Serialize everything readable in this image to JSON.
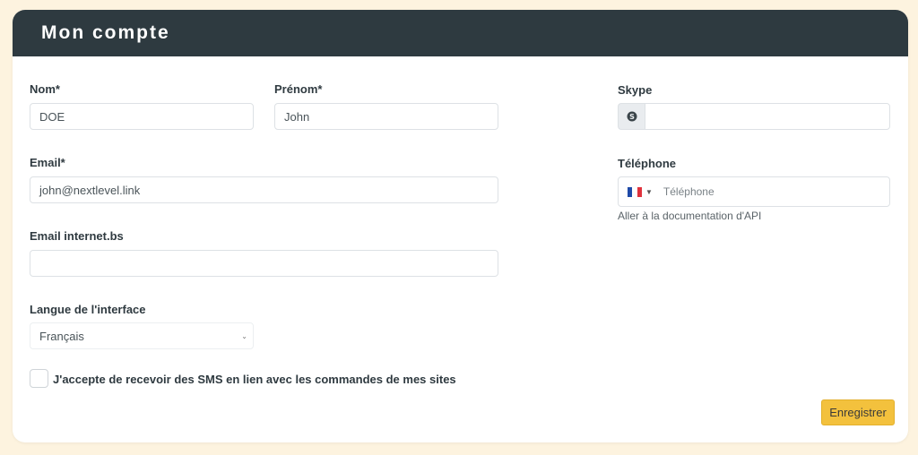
{
  "header": {
    "title": "Mon compte"
  },
  "form": {
    "nom": {
      "label": "Nom*",
      "value": "DOE"
    },
    "prenom": {
      "label": "Prénom*",
      "value": "John"
    },
    "email": {
      "label": "Email*",
      "value": "john@nextlevel.link"
    },
    "email_internet": {
      "label": "Email internet.bs",
      "value": ""
    },
    "langue": {
      "label": "Langue de l'interface",
      "value": "Français"
    },
    "skype": {
      "label": "Skype",
      "value": ""
    },
    "telephone": {
      "label": "Téléphone",
      "placeholder": "Téléphone",
      "country_icon": "france-flag-icon"
    },
    "api_link": "Aller à la documentation d'API",
    "sms_consent": {
      "label": "J'accepte de recevoir des SMS en lien avec les commandes de mes sites",
      "checked": false
    },
    "save_label": "Enregistrer"
  },
  "colors": {
    "background": "#fdf3df",
    "header": "#2e3a40",
    "accent": "#f3c13d"
  }
}
